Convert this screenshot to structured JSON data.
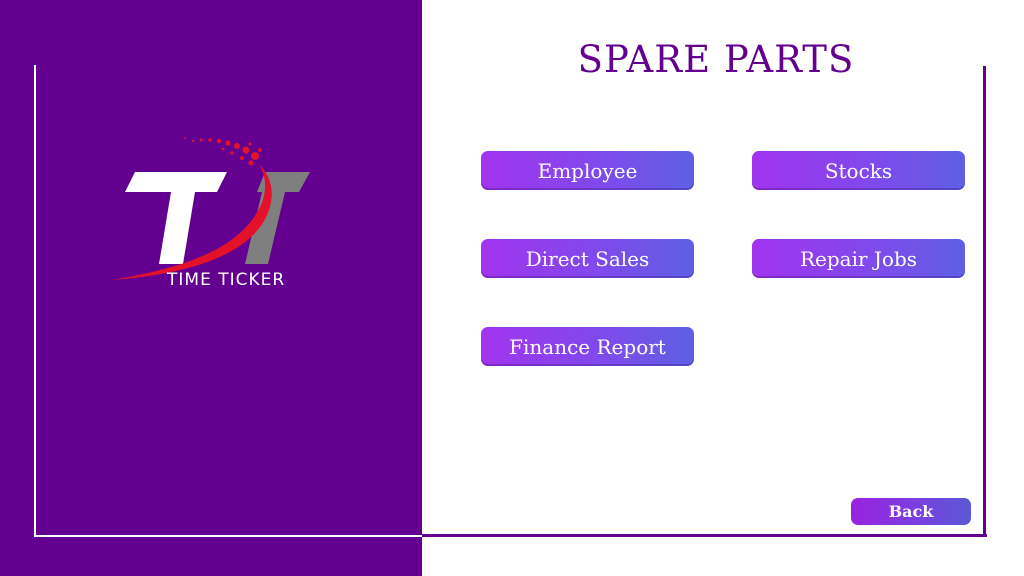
{
  "brand": {
    "logo_text": "TIME TICKER",
    "icon": "time-ticker-logo-icon"
  },
  "header": {
    "title": "SPARE PARTS"
  },
  "menu": {
    "employee": "Employee",
    "stocks": "Stocks",
    "direct_sales": "Direct Sales",
    "repair_jobs": "Repair Jobs",
    "finance_report": "Finance Report"
  },
  "footer": {
    "back_label": "Back"
  },
  "colors": {
    "primary_purple": "#63008f",
    "button_gradient_start": "#a234ef",
    "button_gradient_end": "#5f60e3",
    "logo_red": "#e3122a",
    "logo_gray": "#808080"
  }
}
